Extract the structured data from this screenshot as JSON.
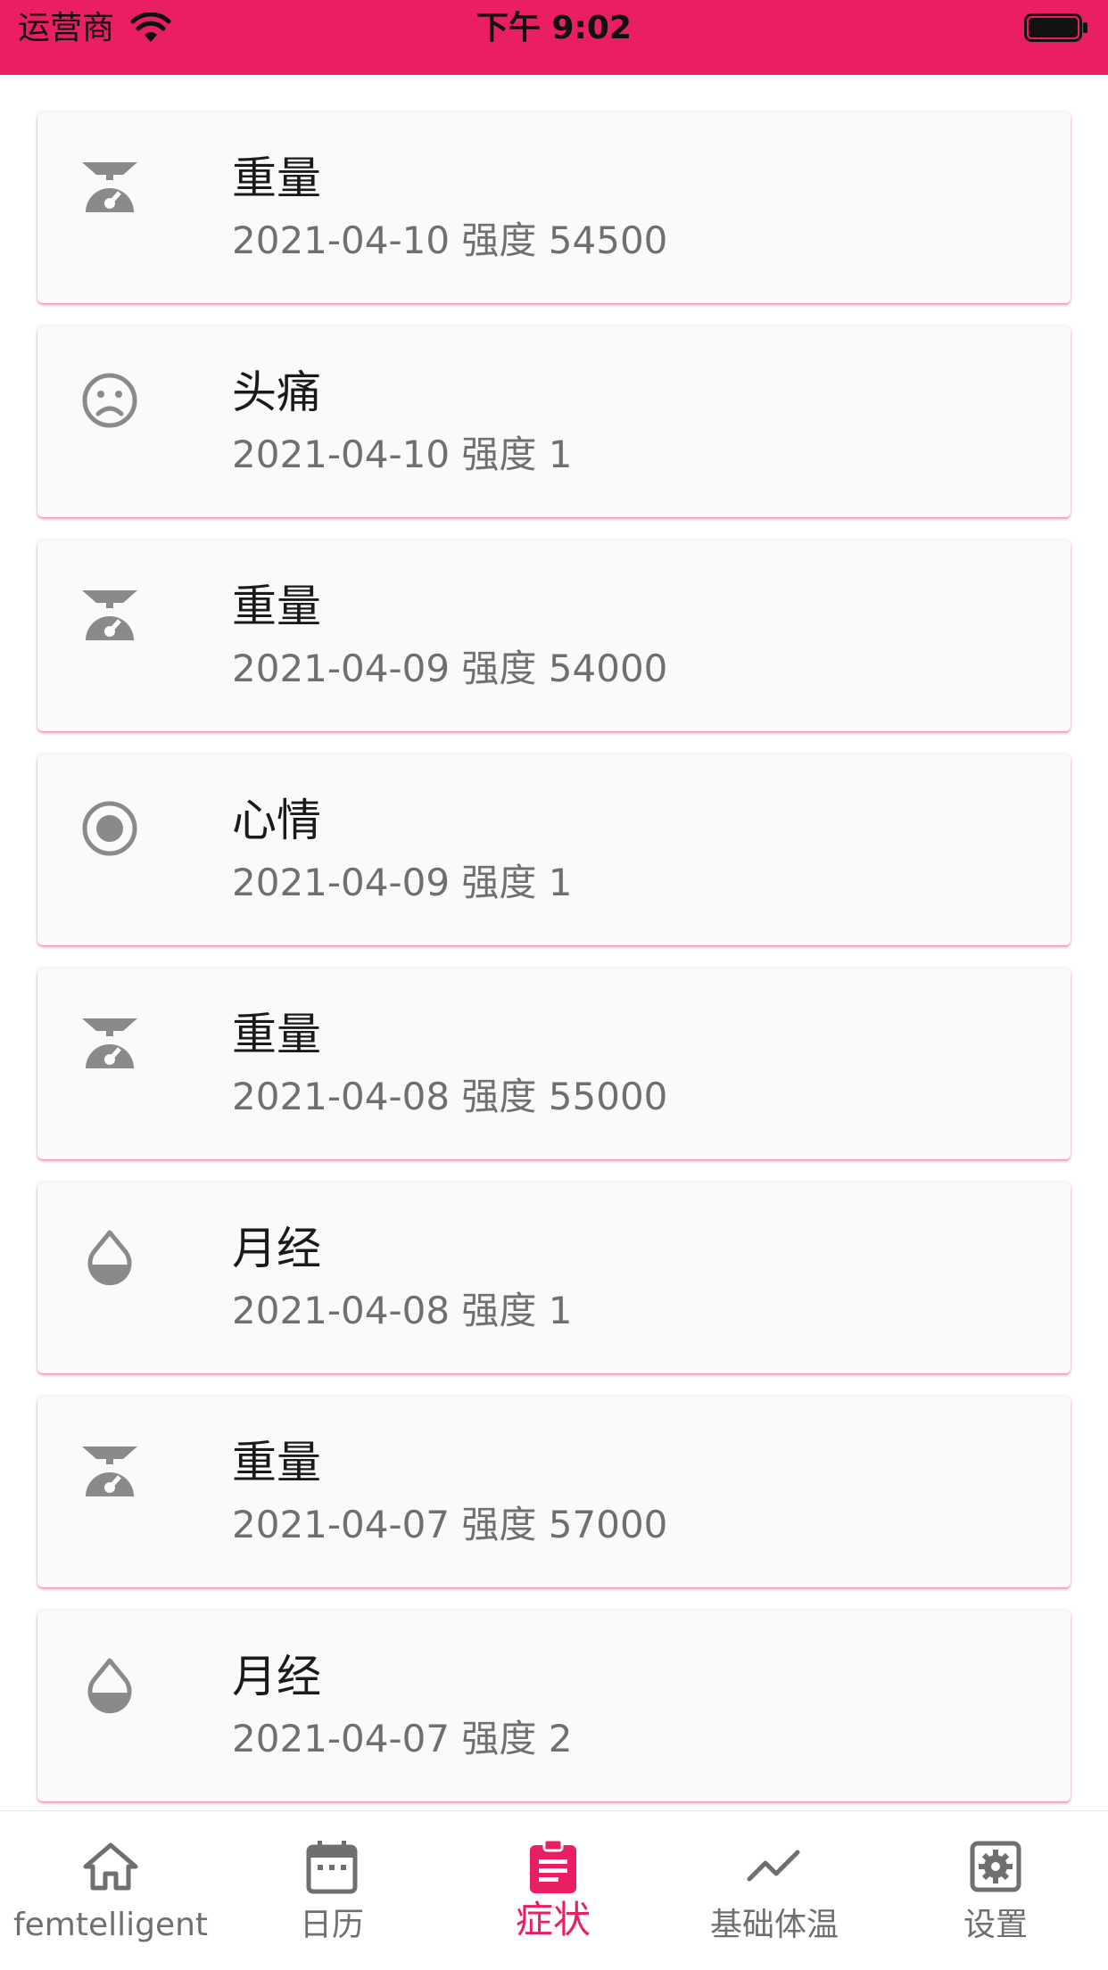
{
  "status_bar": {
    "carrier": "运营商",
    "time": "下午 9:02"
  },
  "colors": {
    "accent": "#E91E63",
    "icon_gray": "#8a8a8a",
    "card_bg": "#fafafa"
  },
  "records": [
    {
      "title": "重量",
      "subtitle": "2021-04-10 强度 54500",
      "icon": "scale-icon"
    },
    {
      "title": "头痛",
      "subtitle": "2021-04-10 强度 1",
      "icon": "sad-face-icon"
    },
    {
      "title": "重量",
      "subtitle": "2021-04-09 强度 54000",
      "icon": "scale-icon"
    },
    {
      "title": "心情",
      "subtitle": "2021-04-09 强度 1",
      "icon": "radio-circle-icon"
    },
    {
      "title": "重量",
      "subtitle": "2021-04-08 强度 55000",
      "icon": "scale-icon"
    },
    {
      "title": "月经",
      "subtitle": "2021-04-08 强度 1",
      "icon": "drop-icon"
    },
    {
      "title": "重量",
      "subtitle": "2021-04-07 强度 57000",
      "icon": "scale-icon"
    },
    {
      "title": "月经",
      "subtitle": "2021-04-07 强度 2",
      "icon": "drop-icon"
    }
  ],
  "bottom_nav": {
    "items": [
      {
        "label": "femtelligent",
        "icon": "home-icon",
        "active": false
      },
      {
        "label": "日历",
        "icon": "calendar-icon",
        "active": false
      },
      {
        "label": "症状",
        "icon": "clipboard-icon",
        "active": true
      },
      {
        "label": "基础体温",
        "icon": "trending-line-icon",
        "active": false
      },
      {
        "label": "设置",
        "icon": "settings-icon",
        "active": false
      }
    ]
  }
}
